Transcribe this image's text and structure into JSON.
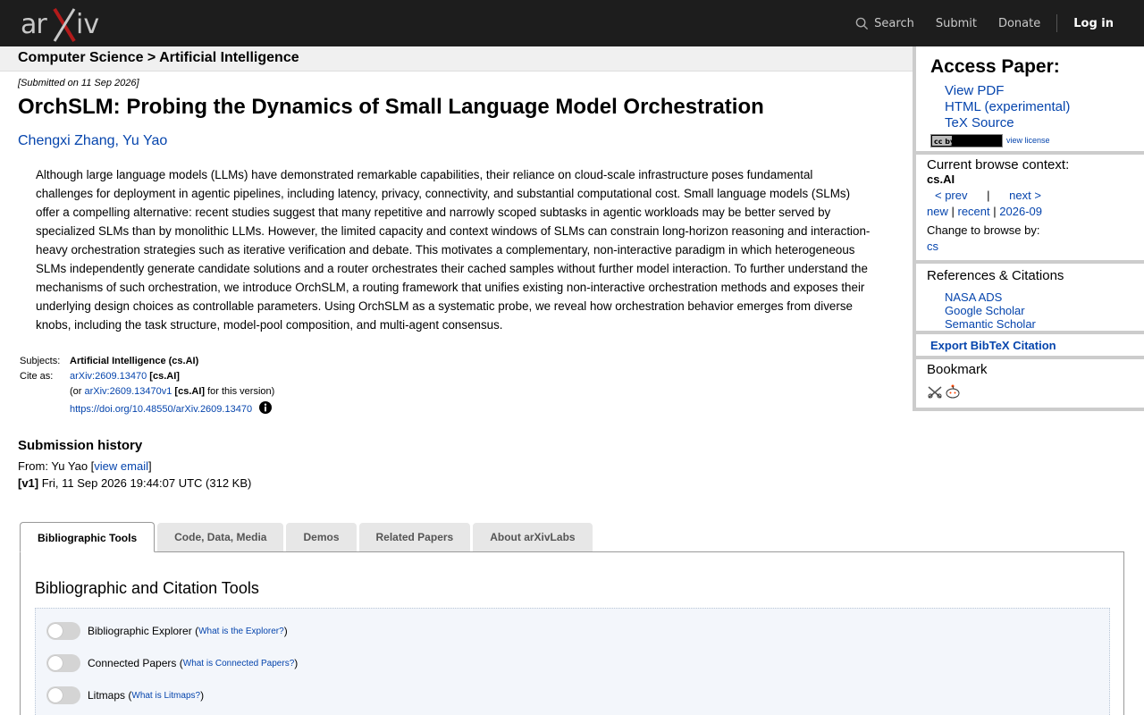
{
  "header": {
    "logo_text": "arXiv",
    "search_label": "Search",
    "submit_label": "Submit",
    "donate_label": "Donate",
    "login_label": "Log in"
  },
  "breadcrumb": "Computer Science > Artificial Intelligence",
  "paper": {
    "submitted": "[Submitted on 11 Sep 2026]",
    "title": "OrchSLM: Probing the Dynamics of Small Language Model Orchestration",
    "authors": [
      "Chengxi Zhang",
      "Yu Yao"
    ],
    "abstract": "Although large language models (LLMs) have demonstrated remarkable capabilities, their reliance on cloud-scale infrastructure poses fundamental challenges for deployment in agentic pipelines, including latency, privacy, connectivity, and substantial computational cost. Small language models (SLMs) offer a compelling alternative: recent studies suggest that many repetitive and narrowly scoped subtasks in agentic workloads may be better served by specialized SLMs than by monolithic LLMs. However, the limited capacity and context windows of SLMs can constrain long-horizon reasoning and interaction-heavy orchestration strategies such as iterative verification and debate. This motivates a complementary, non-interactive paradigm in which heterogeneous SLMs independently generate candidate solutions and a router orchestrates their cached samples without further model interaction. To further understand the mechanisms of such orchestration, we introduce OrchSLM, a routing framework that unifies existing non-interactive orchestration methods and exposes their underlying design choices as controllable parameters. Using OrchSLM as a systematic probe, we reveal how orchestration behavior emerges from diverse knobs, including the task structure, model-pool composition, and multi-agent consensus."
  },
  "meta": {
    "subjects_label": "Subjects:",
    "subjects_value": "Artificial Intelligence (cs.AI)",
    "cite_label": "Cite as:",
    "cite_id": "arXiv:2609.13470",
    "cite_cat": "[cs.AI]",
    "or_prefix": "(or ",
    "version_id": "arXiv:2609.13470v1",
    "version_cat": "[cs.AI]",
    "version_suffix": " for this version)",
    "doi": "https://doi.org/10.48550/arXiv.2609.13470"
  },
  "history": {
    "heading": "Submission history",
    "from_prefix": "From: Yu Yao [",
    "view_email": "view email",
    "from_suffix": "]",
    "v1_label": "[v1]",
    "v1_text": " Fri, 11 Sep 2026 19:44:07 UTC (312 KB)"
  },
  "tabs": [
    {
      "label": "Bibliographic Tools",
      "active": true
    },
    {
      "label": "Code, Data, Media",
      "active": false
    },
    {
      "label": "Demos",
      "active": false
    },
    {
      "label": "Related Papers",
      "active": false
    },
    {
      "label": "About arXivLabs",
      "active": false
    }
  ],
  "panel": {
    "heading": "Bibliographic and Citation Tools",
    "toggles": [
      {
        "label": "Bibliographic Explorer",
        "help": "What is the Explorer?"
      },
      {
        "label": "Connected Papers",
        "help": "What is Connected Papers?"
      },
      {
        "label": "Litmaps",
        "help": "What is Litmaps?"
      }
    ]
  },
  "sidebar": {
    "access_heading": "Access Paper:",
    "view_pdf": "View PDF",
    "html": "HTML (experimental)",
    "tex": "TeX Source",
    "cc_badge_text": "cc by",
    "view_license": "view license",
    "context_heading": "Current browse context:",
    "context_value": "cs.AI",
    "prev": "< prev",
    "pipe": "|",
    "next": "next >",
    "new": "new",
    "recent": "recent",
    "month": "2026-09",
    "change_browse": "Change to browse by:",
    "browse_cs": "cs",
    "refs_heading": "References & Citations",
    "nasa": "NASA ADS",
    "google": "Google Scholar",
    "semantic": "Semantic Scholar",
    "export_bibtex": "Export BibTeX Citation",
    "bookmark_heading": "Bookmark"
  },
  "colors": {
    "header_bg": "#1d1d1d",
    "link": "#0645ad",
    "logo_accent": "#b31b1b"
  }
}
